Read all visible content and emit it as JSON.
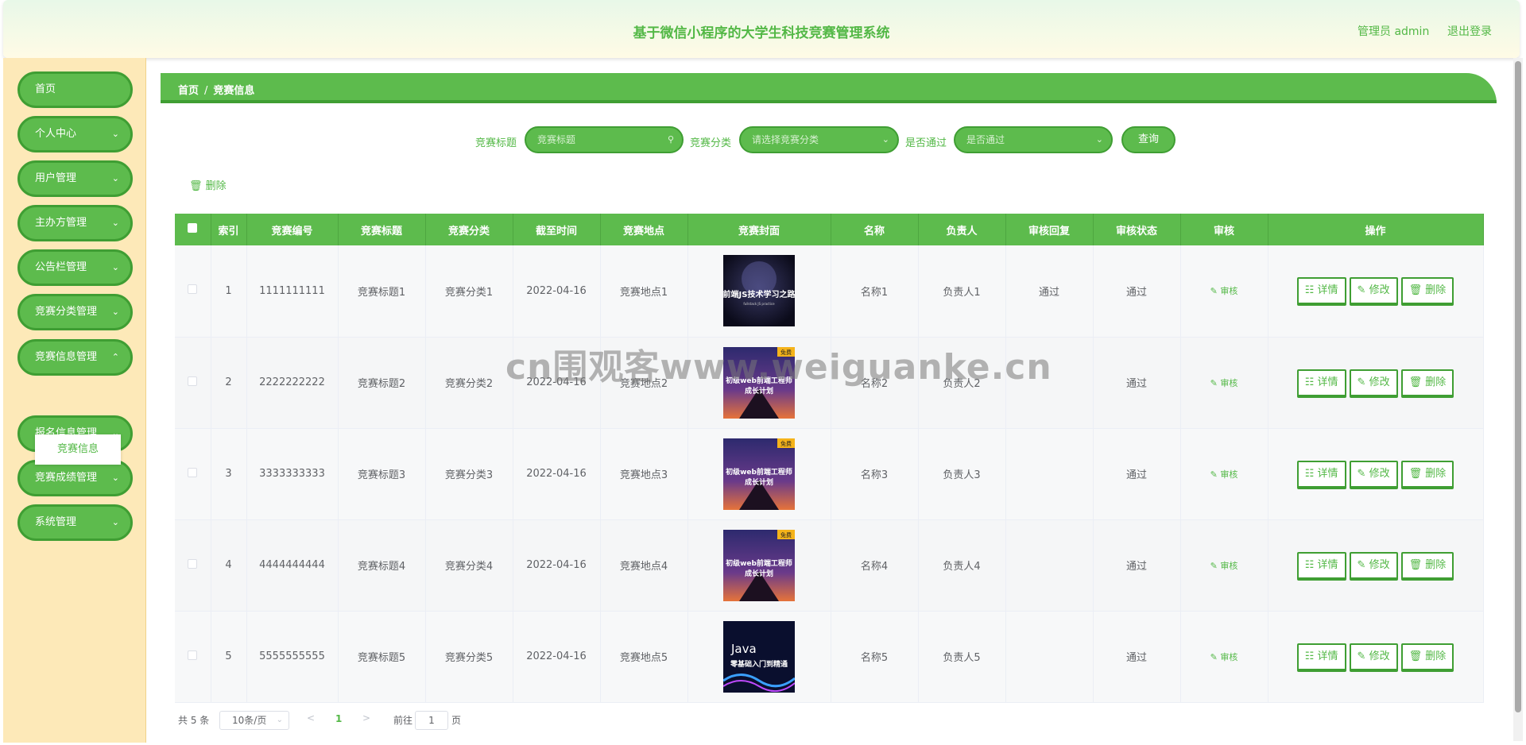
{
  "header": {
    "title": "基于微信小程序的大学生科技竞赛管理系统",
    "user": "管理员 admin",
    "logout": "退出登录"
  },
  "sidebar": {
    "items": [
      {
        "label": "首页",
        "chevron": false
      },
      {
        "label": "个人中心",
        "chevron": true
      },
      {
        "label": "用户管理",
        "chevron": true
      },
      {
        "label": "主办方管理",
        "chevron": true
      },
      {
        "label": "公告栏管理",
        "chevron": true
      },
      {
        "label": "竞赛分类管理",
        "chevron": true
      },
      {
        "label": "竞赛信息管理",
        "chevron": true,
        "expanded": true
      },
      {
        "label": "报名信息管理",
        "chevron": true
      },
      {
        "label": "竞赛成绩管理",
        "chevron": true
      },
      {
        "label": "系统管理",
        "chevron": true
      }
    ],
    "submenu_active": "竞赛信息"
  },
  "breadcrumb": {
    "home": "首页",
    "sep": "/",
    "current": "竞赛信息"
  },
  "search": {
    "title_label": "竞赛标题",
    "title_placeholder": "竞赛标题",
    "category_label": "竞赛分类",
    "category_placeholder": "请选择竞赛分类",
    "passed_label": "是否通过",
    "passed_placeholder": "是否通过",
    "query_button": "查询"
  },
  "toolbar": {
    "delete_label": "删除"
  },
  "table": {
    "columns": [
      "",
      "索引",
      "竞赛编号",
      "竞赛标题",
      "竞赛分类",
      "截至时间",
      "竞赛地点",
      "竞赛封面",
      "名称",
      "负责人",
      "审核回复",
      "审核状态",
      "审核",
      "操作"
    ],
    "rows": [
      {
        "index": "1",
        "code": "1111111111",
        "title": "竞赛标题1",
        "category": "竞赛分类1",
        "deadline": "2022-04-16",
        "place": "竞赛地点1",
        "cover": "js",
        "name": "名称1",
        "owner": "负责人1",
        "reply": "通过",
        "status": "通过"
      },
      {
        "index": "2",
        "code": "2222222222",
        "title": "竞赛标题2",
        "category": "竞赛分类2",
        "deadline": "2022-04-16",
        "place": "竞赛地点2",
        "cover": "web",
        "name": "名称2",
        "owner": "负责人2",
        "reply": "",
        "status": "通过"
      },
      {
        "index": "3",
        "code": "3333333333",
        "title": "竞赛标题3",
        "category": "竞赛分类3",
        "deadline": "2022-04-16",
        "place": "竞赛地点3",
        "cover": "web",
        "name": "名称3",
        "owner": "负责人3",
        "reply": "",
        "status": "通过"
      },
      {
        "index": "4",
        "code": "4444444444",
        "title": "竞赛标题4",
        "category": "竞赛分类4",
        "deadline": "2022-04-16",
        "place": "竞赛地点4",
        "cover": "web",
        "name": "名称4",
        "owner": "负责人4",
        "reply": "",
        "status": "通过"
      },
      {
        "index": "5",
        "code": "5555555555",
        "title": "竞赛标题5",
        "category": "竞赛分类5",
        "deadline": "2022-04-16",
        "place": "竞赛地点5",
        "cover": "java",
        "name": "名称5",
        "owner": "负责人5",
        "reply": "",
        "status": "通过"
      }
    ],
    "audit_link": "审核",
    "detail_button": "详情",
    "edit_button": "修改",
    "delete_button": "删除"
  },
  "covers": {
    "js": {
      "line1": "前端JS技术学习之路",
      "line2": "fullstack JS practice"
    },
    "web": {
      "badge": "免费",
      "line1": "初级web前端工程师",
      "line2": "成长计划"
    },
    "java": {
      "line1": "Java",
      "line2": "零基础入门到精通"
    }
  },
  "pagination": {
    "total": "共 5 条",
    "page_size": "10条/页",
    "current_page": "1",
    "goto_prefix": "前往",
    "goto_value": "1",
    "goto_suffix": "页"
  },
  "watermark": "cn围观客www.weiguanke.cn",
  "colors": {
    "accent": "#5dbb4d",
    "accent_dark": "#3f9e33",
    "sidebar_bg": "#fde9b8",
    "text": "#606266"
  }
}
